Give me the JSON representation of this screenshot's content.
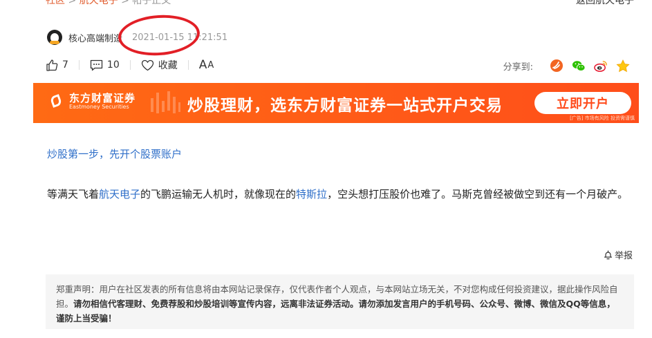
{
  "breadcrumb": {
    "home": "社区",
    "section": "航天电子",
    "current": "帖子正文"
  },
  "top_right_link": "返回航天电子",
  "author": {
    "name": "核心高端制造",
    "time": "2021-01-15 11:21:51"
  },
  "actions": {
    "like_count": "7",
    "comment_count": "10",
    "favorite_label": "收藏",
    "font_label_big": "A",
    "font_label_small": "A"
  },
  "share": {
    "label": "分享到:"
  },
  "banner": {
    "brand_cn": "东方财富证券",
    "brand_en": "Eastmoney Securities",
    "title": "炒股理财，选东方财富证券一站式开户交易",
    "button": "立即开户",
    "ad_note": "[广告] 市场有风险 投资需谨慎"
  },
  "promo_link": "炒股第一步，先开个股票账户",
  "post": {
    "part1": "等满天飞着",
    "link1": "航天电子",
    "part2": "的飞鹏运输无人机时，就像现在的",
    "link2": "特斯拉",
    "part3": "，空头想打压股价也难了。马斯克曾经被做空到还有一个月破产。"
  },
  "report_label": "举报",
  "disclaimer": {
    "normal": "郑重声明：用户在社区发表的所有信息将由本网站记录保存，仅代表作者个人观点，与本网站立场无关，不对您构成任何投资建议，据此操作风险自担。",
    "bold": "请勿相信代客理财、免费荐股和炒股培训等宣传内容，远离非法证券活动。请勿添加发言用户的手机号码、公众号、微博、微信及QQ等信息，谨防上当受骗！"
  },
  "colors": {
    "accent_red": "#e21f26",
    "banner_orange": "#ff5a18",
    "link_blue": "#2f6fc9"
  }
}
